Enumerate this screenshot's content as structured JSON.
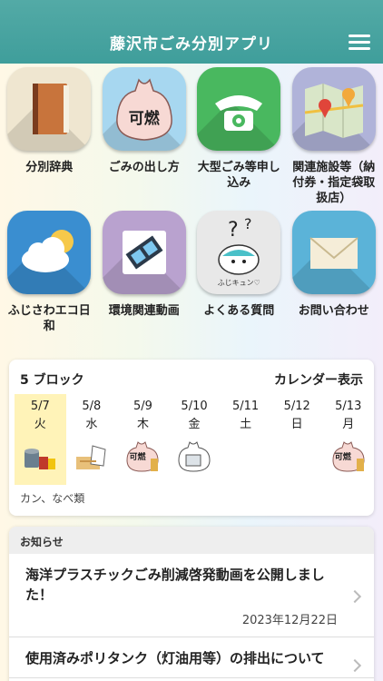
{
  "header": {
    "title": "藤沢市ごみ分別アプリ",
    "menu_icon": "hamburger-menu-icon"
  },
  "tiles": [
    {
      "label": "分別辞典",
      "icon": "book-icon"
    },
    {
      "label": "ごみの出し方",
      "icon": "garbage-bag-icon",
      "bag_text": "可燃"
    },
    {
      "label": "大型ごみ等申し込み",
      "icon": "telephone-icon"
    },
    {
      "label": "関連施設等（納付券・指定袋取扱店）",
      "icon": "map-pin-icon"
    },
    {
      "label": "ふじさわエコ日和",
      "icon": "cloud-sun-icon"
    },
    {
      "label": "環境関連動画",
      "icon": "film-icon"
    },
    {
      "label": "よくある質問",
      "icon": "mascot-question-icon",
      "mascot_text": "ふじキュン♡"
    },
    {
      "label": "お問い合わせ",
      "icon": "envelope-icon"
    }
  ],
  "calendar": {
    "block": "5 ブロック",
    "view_link": "カレンダー表示",
    "days": [
      {
        "date": "5/7",
        "weekday": "火",
        "icon": "cans-pots-icon",
        "today": true
      },
      {
        "date": "5/8",
        "weekday": "水",
        "icon": "paper-recycle-icon"
      },
      {
        "date": "5/9",
        "weekday": "木",
        "icon": "burnable-bag-icon",
        "bag_text": "可燃"
      },
      {
        "date": "5/10",
        "weekday": "金",
        "icon": "plastic-bag-icon"
      },
      {
        "date": "5/11",
        "weekday": "土",
        "icon": ""
      },
      {
        "date": "5/12",
        "weekday": "日",
        "icon": ""
      },
      {
        "date": "5/13",
        "weekday": "月",
        "icon": "burnable-bag-icon",
        "bag_text": "可燃"
      }
    ],
    "today_category": "カン、なべ類"
  },
  "news": {
    "heading": "お知らせ",
    "items": [
      {
        "title": "海洋プラスチックごみ削減啓発動画を公開しました！",
        "date": "2023年12月22日"
      },
      {
        "title": "使用済みポリタンク（灯油用等）の排出について",
        "date": ""
      }
    ]
  },
  "colors": {
    "header": "#4aa6a2",
    "today_highlight": "#fff3b8"
  }
}
